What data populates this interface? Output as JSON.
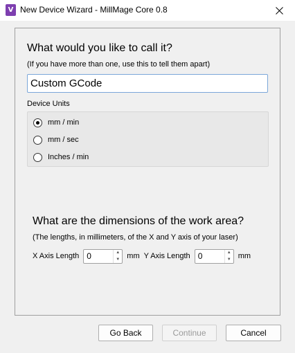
{
  "window": {
    "title": "New Device Wizard - MillMage Core 0.8",
    "app_icon_letter": "V"
  },
  "name_section": {
    "heading": "What would you like to call it?",
    "subtext": "(If you have more than one, use this to tell them apart)",
    "device_name": "Custom GCode"
  },
  "units": {
    "label": "Device Units",
    "options": [
      {
        "label": "mm / min",
        "selected": true
      },
      {
        "label": "mm / sec",
        "selected": false
      },
      {
        "label": "Inches / min",
        "selected": false
      }
    ]
  },
  "dimensions": {
    "heading": "What are the dimensions of the work area?",
    "subtext": "(The lengths, in millimeters, of the X and Y axis of your laser)",
    "x_label": "X Axis Length",
    "x_value": "0",
    "x_unit": "mm",
    "y_label": "Y Axis Length",
    "y_value": "0",
    "y_unit": "mm"
  },
  "buttons": {
    "back": "Go Back",
    "continue": "Continue",
    "cancel": "Cancel"
  },
  "colors": {
    "accent": "#7e3fb0",
    "input_focus_border": "#7aa6d9"
  }
}
